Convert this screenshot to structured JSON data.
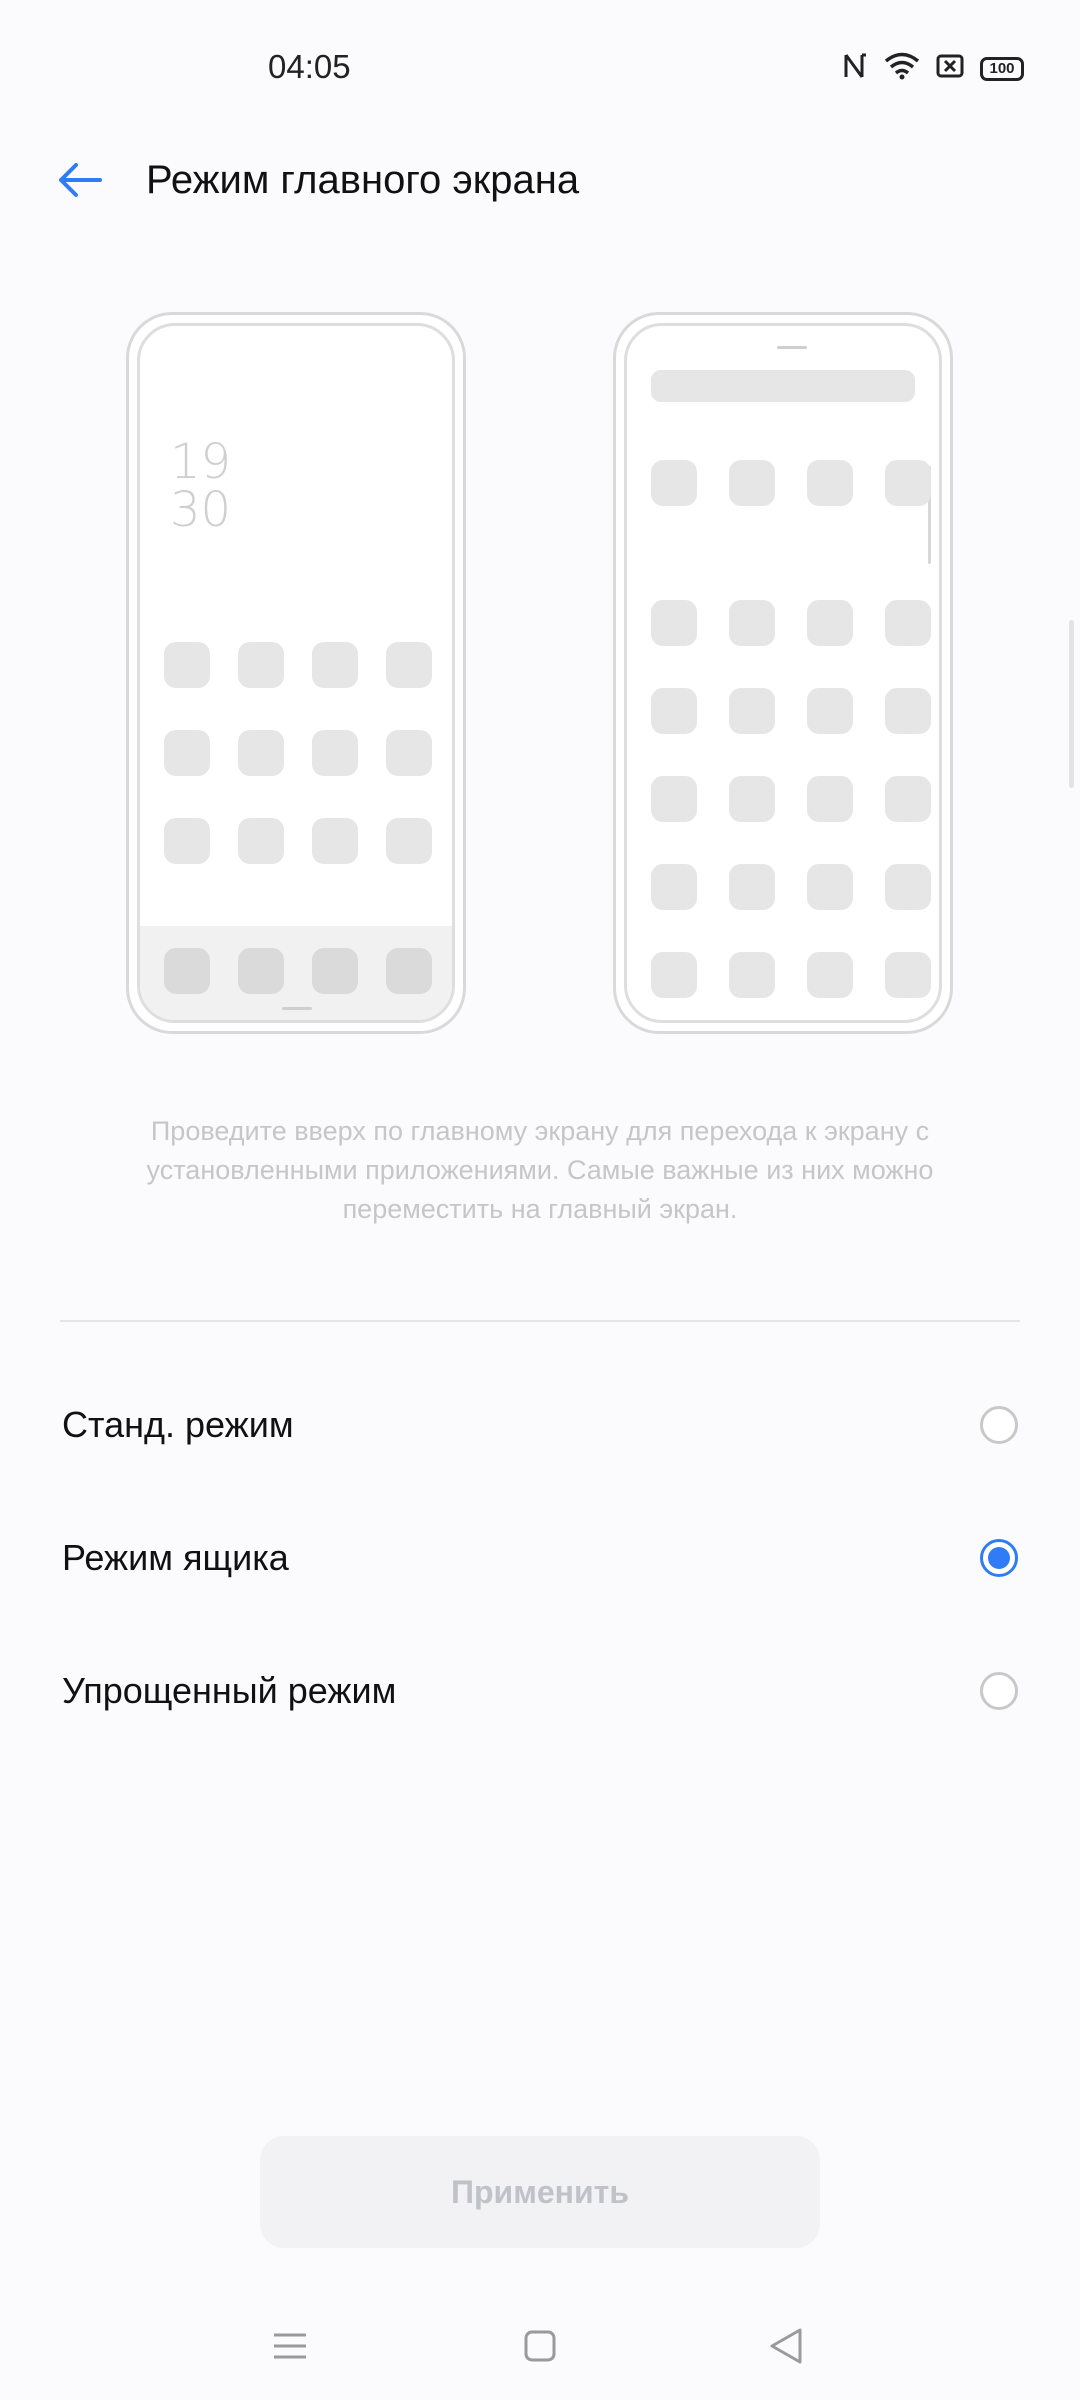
{
  "status_bar": {
    "time": "04:05",
    "battery": "100",
    "icons": [
      "nfc-icon",
      "wifi-icon",
      "close-box-icon",
      "battery-icon"
    ]
  },
  "header": {
    "title": "Режим главного экрана",
    "back_icon": "arrow-left-icon"
  },
  "preview": {
    "clock_hour": "19",
    "clock_minute": "30"
  },
  "description": "Проведите вверх по главному экрану для перехода к экрану с установленными приложениями. Самые важные из них можно переместить на главный экран.",
  "options": [
    {
      "label": "Станд. режим",
      "selected": false
    },
    {
      "label": "Режим ящика",
      "selected": true
    },
    {
      "label": "Упрощенный режим",
      "selected": false
    }
  ],
  "apply_button": "Применить",
  "colors": {
    "accent": "#2f7cf6",
    "background": "#fbfbfd",
    "disabled_text": "#bfc2c8"
  },
  "nav_bar": [
    "menu-icon",
    "home-icon",
    "back-triangle-icon"
  ]
}
